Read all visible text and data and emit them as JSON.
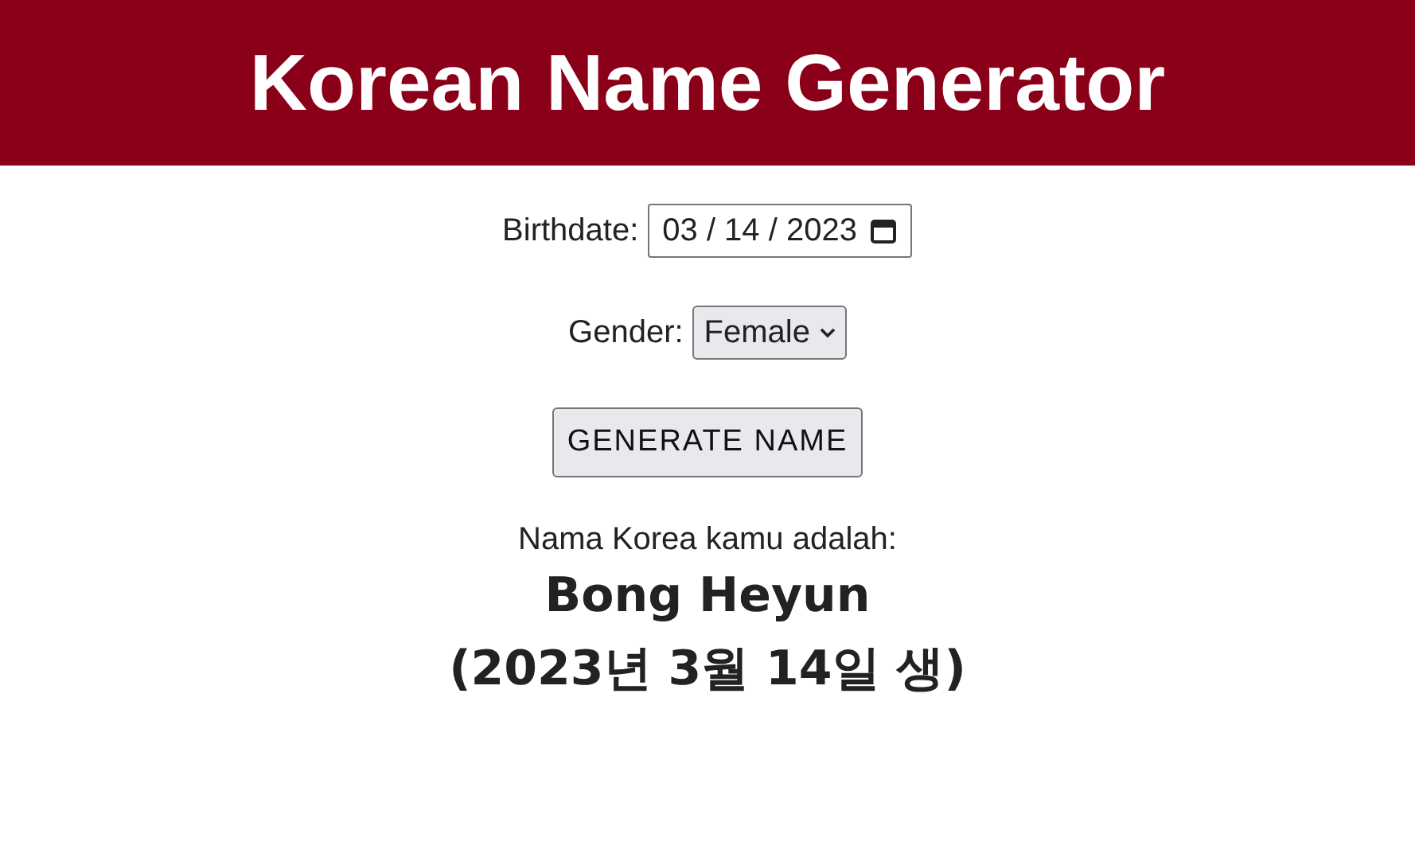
{
  "header": {
    "title": "Korean Name Generator"
  },
  "birthdate": {
    "label": "Birthdate:",
    "value": "03 / 14 / 2023"
  },
  "gender": {
    "label": "Gender:",
    "value": "Female"
  },
  "button": "GENERATE NAME",
  "result": {
    "intro": "Nama Korea kamu adalah:",
    "name": "Bong Heyun",
    "date": "(2023년 3월 14일 생)"
  }
}
